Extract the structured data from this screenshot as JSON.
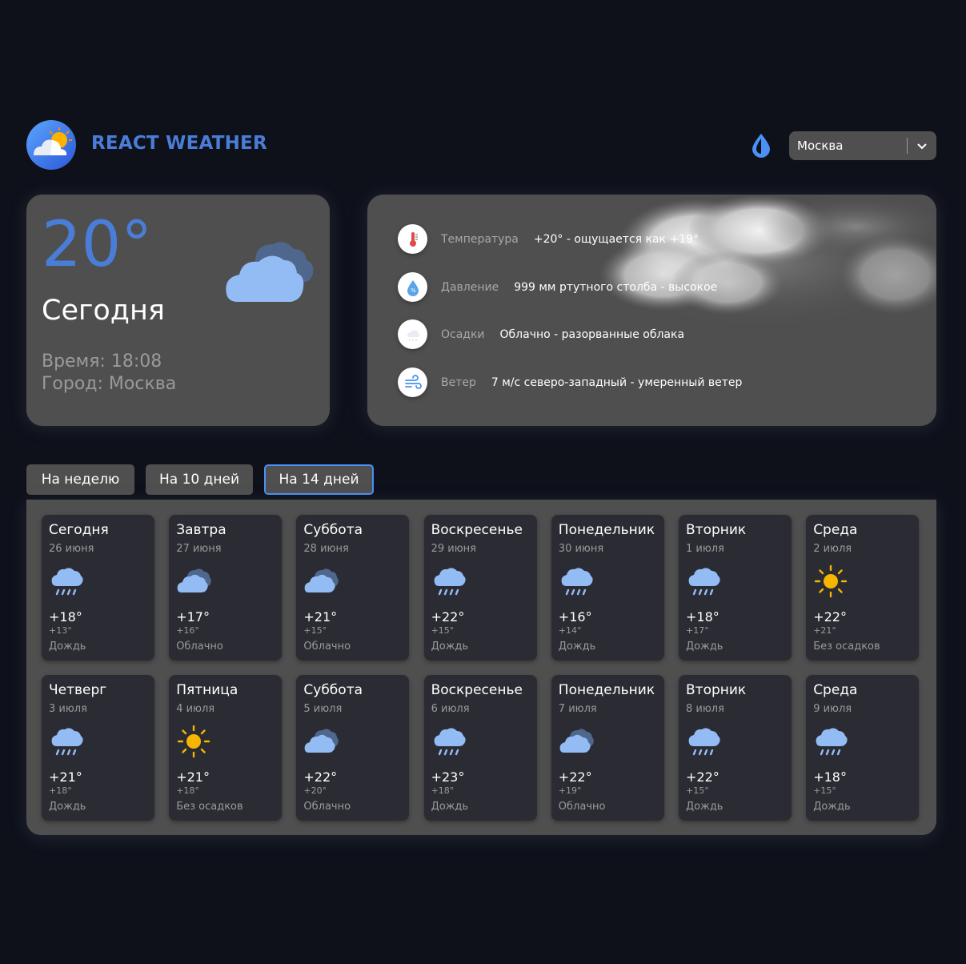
{
  "header": {
    "brand": "REACT WEATHER",
    "city_select_value": "Москва",
    "logo_icon": "weather-logo-icon",
    "theme_icon": "drop-icon"
  },
  "today": {
    "temp": "20°",
    "day": "Сегодня",
    "time": "Время: 18:08",
    "city": "Город: Москва",
    "icon": "cloudy-icon"
  },
  "details": [
    {
      "icon": "thermometer-icon",
      "label": "Температура",
      "value": "+20° - ощущается как +19°"
    },
    {
      "icon": "pressure-icon",
      "label": "Давление",
      "value": "999 мм ртутного столба - высокое"
    },
    {
      "icon": "precipitation-icon",
      "label": "Осадки",
      "value": "Облачно - разорванные облака"
    },
    {
      "icon": "wind-icon",
      "label": "Ветер",
      "value": "7 м/с северо-западный - умеренный ветер"
    }
  ],
  "tabs": [
    "На неделю",
    "На 10 дней",
    "На 14 дней"
  ],
  "active_tab": "На 14 дней",
  "forecast": [
    {
      "day": "Сегодня",
      "date": "26 июня",
      "icon": "rain",
      "max": "+18°",
      "min": "+13°",
      "desc": "Дождь"
    },
    {
      "day": "Завтра",
      "date": "27 июня",
      "icon": "cloudy",
      "max": "+17°",
      "min": "+16°",
      "desc": "Облачно"
    },
    {
      "day": "Суббота",
      "date": "28 июня",
      "icon": "cloudy",
      "max": "+21°",
      "min": "+15°",
      "desc": "Облачно"
    },
    {
      "day": "Воскресенье",
      "date": "29 июня",
      "icon": "rain",
      "max": "+22°",
      "min": "+15°",
      "desc": "Дождь"
    },
    {
      "day": "Понедельник",
      "date": "30 июня",
      "icon": "rain",
      "max": "+16°",
      "min": "+14°",
      "desc": "Дождь"
    },
    {
      "day": "Вторник",
      "date": "1 июля",
      "icon": "rain",
      "max": "+18°",
      "min": "+17°",
      "desc": "Дождь"
    },
    {
      "day": "Среда",
      "date": "2 июля",
      "icon": "sun",
      "max": "+22°",
      "min": "+21°",
      "desc": "Без осадков"
    },
    {
      "day": "Четверг",
      "date": "3 июля",
      "icon": "rain",
      "max": "+21°",
      "min": "+18°",
      "desc": "Дождь"
    },
    {
      "day": "Пятница",
      "date": "4 июля",
      "icon": "sun",
      "max": "+21°",
      "min": "+18°",
      "desc": "Без осадков"
    },
    {
      "day": "Суббота",
      "date": "5 июля",
      "icon": "cloudy",
      "max": "+22°",
      "min": "+20°",
      "desc": "Облачно"
    },
    {
      "day": "Воскресенье",
      "date": "6 июля",
      "icon": "rain",
      "max": "+23°",
      "min": "+18°",
      "desc": "Дождь"
    },
    {
      "day": "Понедельник",
      "date": "7 июля",
      "icon": "cloudy",
      "max": "+22°",
      "min": "+19°",
      "desc": "Облачно"
    },
    {
      "day": "Вторник",
      "date": "8 июля",
      "icon": "rain",
      "max": "+22°",
      "min": "+15°",
      "desc": "Дождь"
    },
    {
      "day": "Среда",
      "date": "9 июля",
      "icon": "rain",
      "max": "+18°",
      "min": "+15°",
      "desc": "Дождь"
    }
  ],
  "colors": {
    "accent": "#4a7dd8",
    "card": "#4f4f4f",
    "day_card": "#2b2c33",
    "background": "#0e111a",
    "sun": "#f6b500"
  }
}
